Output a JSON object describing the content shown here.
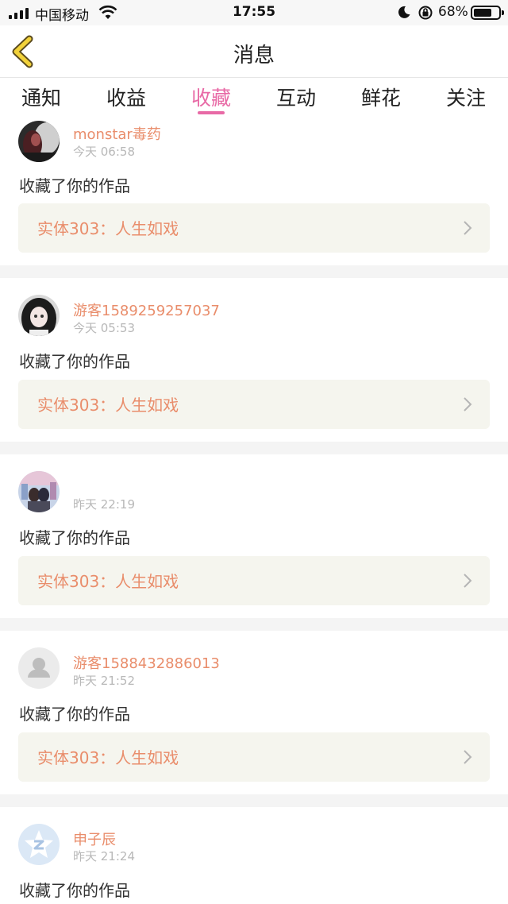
{
  "status_bar": {
    "carrier": "中国移动",
    "time": "17:55",
    "battery": "68%"
  },
  "header": {
    "title": "消息"
  },
  "tabs": [
    {
      "label": "通知",
      "active": false
    },
    {
      "label": "收益",
      "active": false
    },
    {
      "label": "收藏",
      "active": true
    },
    {
      "label": "互动",
      "active": false
    },
    {
      "label": "鲜花",
      "active": false
    },
    {
      "label": "关注",
      "active": false
    }
  ],
  "messages": [
    {
      "user": "monstar毒药",
      "time": "今天 06:58",
      "action": "收藏了你的作品",
      "work": "实体303：人生如戏",
      "avatar": "photo-dark"
    },
    {
      "user": "游客1589259257037",
      "time": "今天 05:53",
      "action": "收藏了你的作品",
      "work": "实体303：人生如戏",
      "avatar": "anime-girl"
    },
    {
      "user": "",
      "time": "昨天 22:19",
      "action": "收藏了你的作品",
      "work": "实体303：人生如戏",
      "avatar": "photo-couple"
    },
    {
      "user": "游客1588432886013",
      "time": "昨天 21:52",
      "action": "收藏了你的作品",
      "work": "实体303：人生如戏",
      "avatar": "default-user"
    },
    {
      "user": "申子辰",
      "time": "昨天 21:24",
      "action": "收藏了你的作品",
      "work": "实体303：人生如戏",
      "avatar": "qq-star"
    }
  ],
  "colors": {
    "accent_tab": "#e86aa6",
    "username": "#e98d6b",
    "work_box_bg": "#f5f5ee",
    "back_arrow": "#f2d23a"
  }
}
